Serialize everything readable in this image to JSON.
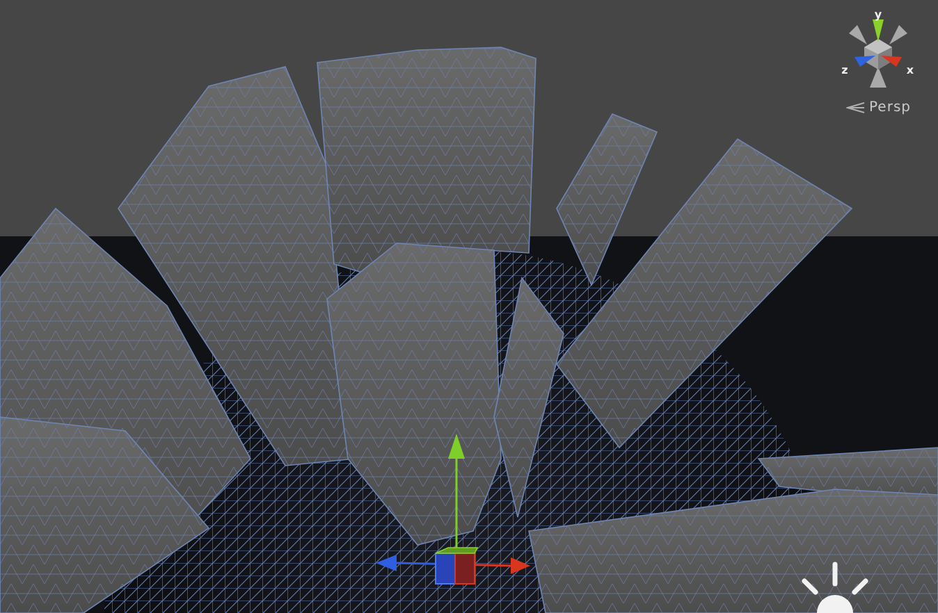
{
  "scene_gizmo": {
    "axes": [
      {
        "label": "y",
        "color": "#8ad12a"
      },
      {
        "label": "z",
        "color": "#2f63e0"
      },
      {
        "label": "x",
        "color": "#d8361e"
      }
    ],
    "projection": "Persp"
  }
}
